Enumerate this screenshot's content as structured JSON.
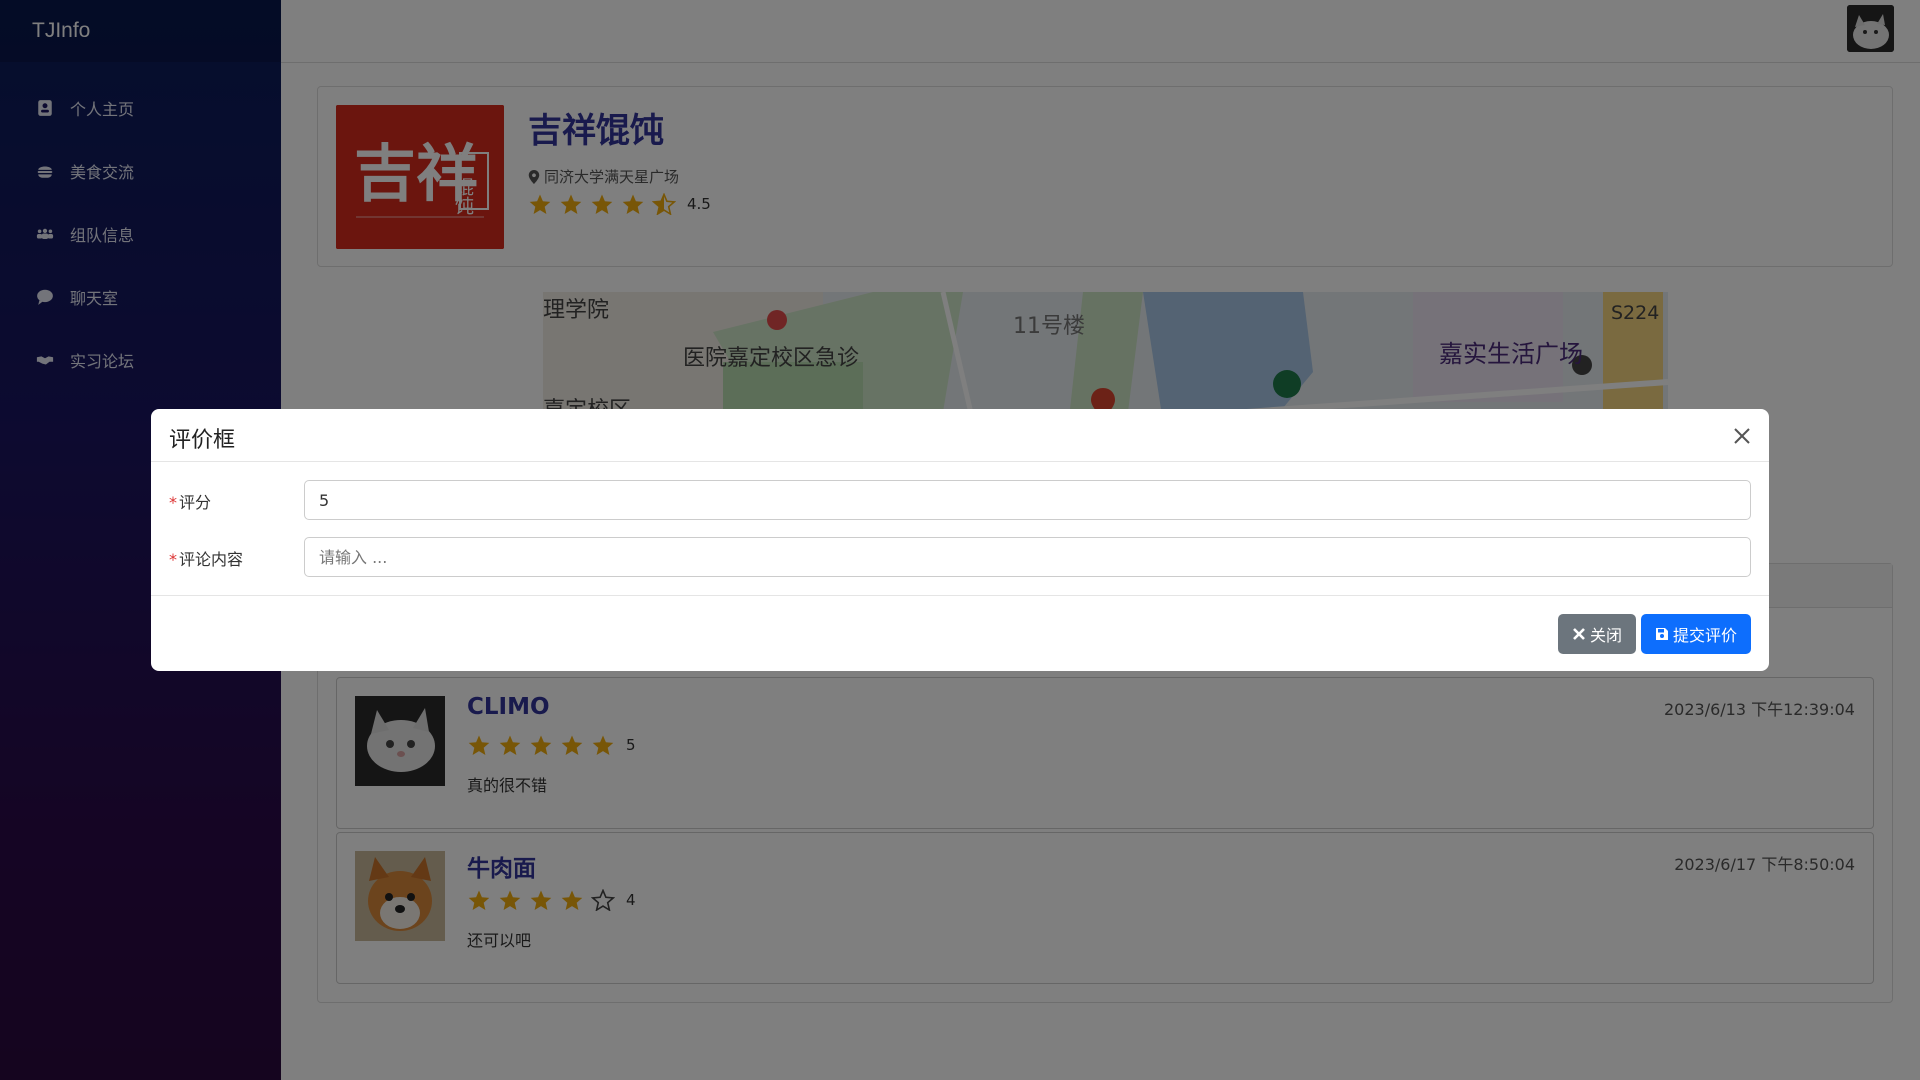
{
  "app": {
    "brand": "TJInfo"
  },
  "sidebar": {
    "items": [
      {
        "label": "个人主页",
        "icon": "address-card-icon"
      },
      {
        "label": "美食交流",
        "icon": "burger-icon"
      },
      {
        "label": "组队信息",
        "icon": "users-icon"
      },
      {
        "label": "聊天室",
        "icon": "comment-icon"
      },
      {
        "label": "实习论坛",
        "icon": "handshake-icon"
      }
    ]
  },
  "restaurant": {
    "name": "吉祥馄饨",
    "location": "同济大学满天星广场",
    "rating": "4.5",
    "rating_value": 4.5,
    "logo_text": "吉祥",
    "logo_side_text": "馄饨"
  },
  "map": {
    "labels": [
      "理学院",
      "医院嘉定校区急诊",
      "11号楼",
      "S224",
      "嘉实生活广场",
      "嘉定校区"
    ]
  },
  "comments": [
    {
      "user": "CLIMO",
      "rating": "5",
      "rating_value": 5,
      "text": "真的很不错",
      "time": "2023/6/13 下午12:39:04"
    },
    {
      "user": "牛肉面",
      "rating": "4",
      "rating_value": 4,
      "text": "还可以吧",
      "time": "2023/6/17 下午8:50:04"
    }
  ],
  "modal": {
    "title": "评价框",
    "score_label": "评分",
    "score_value": "5",
    "content_label": "评论内容",
    "content_placeholder": "请输入 ...",
    "close_label": "关闭",
    "submit_label": "提交评价"
  },
  "colors": {
    "accent": "#0d6efd",
    "secondary": "#6c757d",
    "star": "#f0ad0f",
    "title": "#33349a"
  }
}
